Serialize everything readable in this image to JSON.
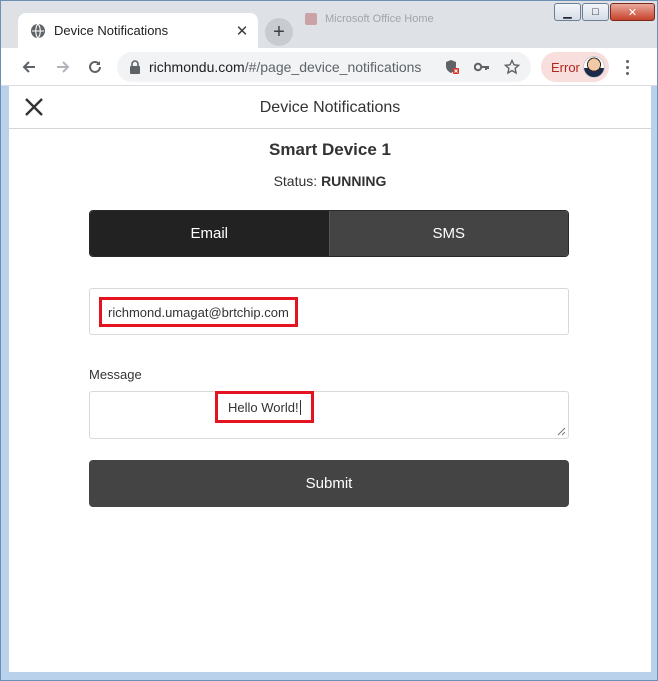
{
  "browser": {
    "tab_title": "Device Notifications",
    "tab_close_icon": "close-icon",
    "new_tab_label": "+",
    "background_tab_title": "Microsoft Office Home",
    "window_controls": {
      "minimize": "▁",
      "maximize": "□",
      "close": "✕"
    },
    "url_host": "richmondu.com",
    "url_path": "/#/page_device_notifications",
    "profile_status": "Error"
  },
  "app": {
    "header_title": "Device Notifications",
    "device_name": "Smart Device 1",
    "status_label": "Status:",
    "status_value": "RUNNING",
    "tabs": [
      {
        "label": "Email",
        "active": true
      },
      {
        "label": "SMS",
        "active": false
      }
    ],
    "email_value": "richmond.umagat@brtchip.com",
    "message_label": "Message",
    "message_value": "Hello World!",
    "submit_label": "Submit"
  },
  "colors": {
    "active_tab": "#222222",
    "inactive_tab": "#444444",
    "submit_button": "#444444",
    "highlight_border": "#e3141f",
    "error_pill": "#f8dedd"
  }
}
